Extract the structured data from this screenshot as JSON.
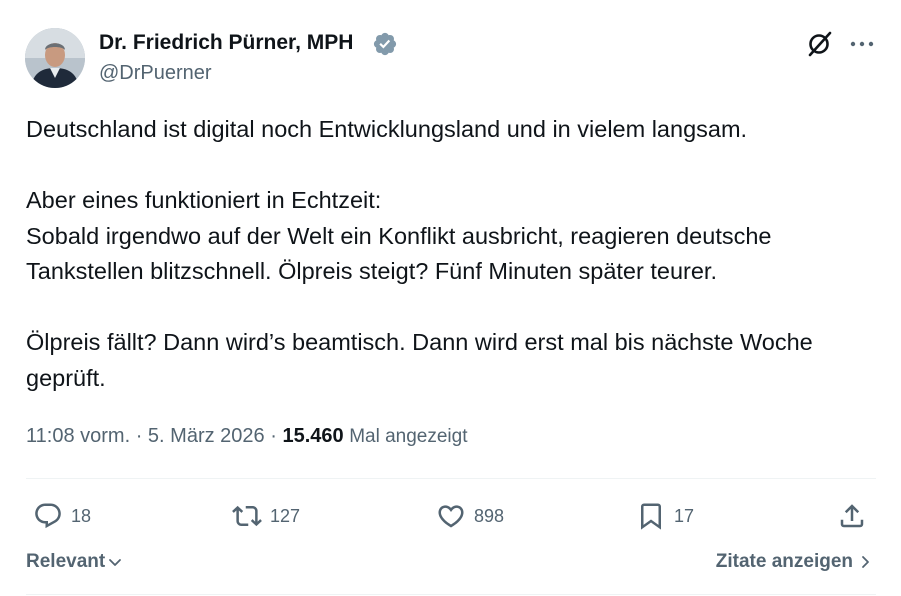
{
  "author": {
    "display_name": "Dr. Friedrich Pürner, MPH",
    "handle": "@DrPuerner",
    "verified_color": "#829aab"
  },
  "tweet": {
    "paragraphs": [
      "Deutschland ist digital noch Entwicklungsland und in vielem langsam.",
      "Aber eines funktioniert in Echtzeit:\nSobald irgendwo auf der Welt ein Konflikt ausbricht, reagieren deutsche Tankstellen blitzschnell. Ölpreis steigt? Fünf Minuten später teurer.",
      "Ölpreis fällt? Dann wird’s beamtisch. Dann wird erst mal bis nächste Woche geprüft."
    ],
    "time": "11:08 vorm.",
    "separator": "·",
    "date": "5. März 2026",
    "views_count": "15.460",
    "views_label": "Mal angezeigt"
  },
  "actions": {
    "replies": "18",
    "reposts": "127",
    "likes": "898",
    "bookmarks": "17"
  },
  "footer": {
    "sort_label": "Relevant",
    "quotes_label": "Zitate anzeigen"
  },
  "icons": {
    "header": [
      "grok-icon",
      "more-icon"
    ],
    "actions": [
      "reply-icon",
      "repost-icon",
      "like-icon",
      "bookmark-icon",
      "share-icon"
    ]
  },
  "colors": {
    "text_primary": "#0f1419",
    "text_secondary": "#536471",
    "divider": "#eff3f4"
  }
}
